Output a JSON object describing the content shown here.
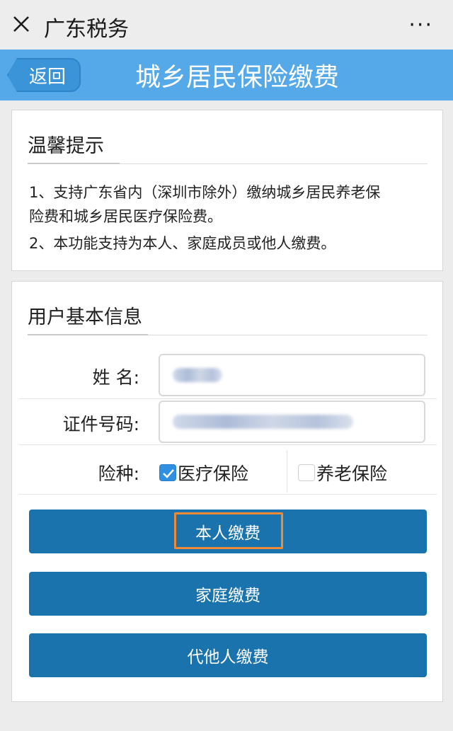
{
  "wechat_bar": {
    "title": "广东税务",
    "more": "···"
  },
  "header": {
    "back_label": "返回",
    "title": "城乡居民保险缴费"
  },
  "tips": {
    "title": "温馨提示",
    "lines": [
      "1、支持广东省内（深圳市除外）缴纳城乡居民养老保",
      "险费和城乡居民医疗保险费。",
      "2、本功能支持为本人、家庭成员或他人缴费。"
    ]
  },
  "user_info": {
    "title": "用户基本信息",
    "name_label": "姓 名:",
    "id_label": "证件号码:",
    "insurance_label": "险种:",
    "options": [
      {
        "label": "医疗保险",
        "checked": true
      },
      {
        "label": "养老保险",
        "checked": false
      }
    ]
  },
  "buttons": {
    "self_pay": "本人缴费",
    "family_pay": "家庭缴费",
    "other_pay": "代他人缴费"
  },
  "colors": {
    "header_blue": "#55a9e8",
    "button_blue": "#1a73ad",
    "checkbox_blue": "#2f8fe0",
    "highlight_orange": "#f08a36"
  }
}
